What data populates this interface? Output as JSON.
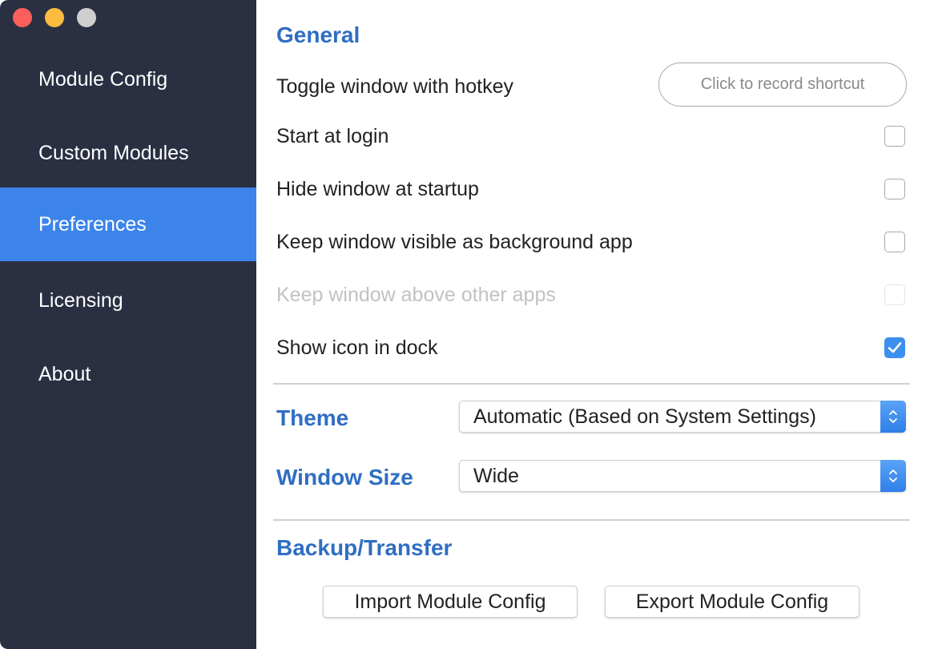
{
  "window": {
    "controls": [
      "close",
      "minimize",
      "zoom"
    ]
  },
  "sidebar": {
    "items": [
      {
        "label": "Module Config",
        "active": false
      },
      {
        "label": "Custom Modules",
        "active": false
      },
      {
        "label": "Preferences",
        "active": true
      },
      {
        "label": "Licensing",
        "active": false
      },
      {
        "label": "About",
        "active": false
      }
    ]
  },
  "general": {
    "title": "General",
    "hotkey": {
      "label": "Toggle window with hotkey",
      "button_label": "Click to record shortcut"
    },
    "options": [
      {
        "label": "Start at login",
        "checked": false,
        "disabled": false
      },
      {
        "label": "Hide window at startup",
        "checked": false,
        "disabled": false
      },
      {
        "label": "Keep window visible as background app",
        "checked": false,
        "disabled": false
      },
      {
        "label": "Keep window above other apps",
        "checked": false,
        "disabled": true
      },
      {
        "label": "Show icon in dock",
        "checked": true,
        "disabled": false
      }
    ]
  },
  "theme": {
    "label": "Theme",
    "selected": "Automatic (Based on System Settings)"
  },
  "window_size": {
    "label": "Window Size",
    "selected": "Wide"
  },
  "backup": {
    "title": "Backup/Transfer",
    "import_label": "Import Module Config",
    "export_label": "Export Module Config"
  },
  "colors": {
    "sidebar_bg": "#2a3042",
    "sidebar_active": "#3c84ea",
    "accent": "#2f6ec2",
    "checkbox_checked": "#3d8fef"
  }
}
